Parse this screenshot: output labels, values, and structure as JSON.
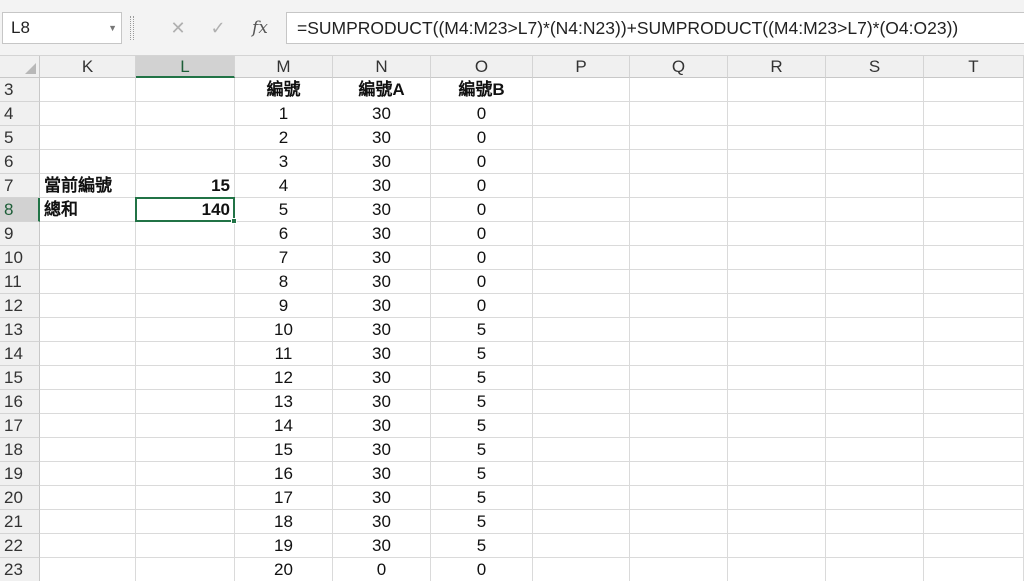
{
  "name_box": {
    "value": "L8"
  },
  "formula_bar": {
    "cancel_icon": "close-icon",
    "enter_icon": "check-icon",
    "fx_label": "fx",
    "formula": "=SUMPRODUCT((M4:M23>L7)*(N4:N23))+SUMPRODUCT((M4:M23>L7)*(O4:O23))"
  },
  "columns": [
    "K",
    "L",
    "M",
    "N",
    "O",
    "P",
    "Q",
    "R",
    "S",
    "T"
  ],
  "active_column": "L",
  "active_row": "8",
  "rows": [
    {
      "num": "3",
      "K": "",
      "L": "",
      "M": "編號",
      "N": "編號A",
      "O": "編號B"
    },
    {
      "num": "4",
      "K": "",
      "L": "",
      "M": "1",
      "N": "30",
      "O": "0"
    },
    {
      "num": "5",
      "K": "",
      "L": "",
      "M": "2",
      "N": "30",
      "O": "0"
    },
    {
      "num": "6",
      "K": "",
      "L": "",
      "M": "3",
      "N": "30",
      "O": "0"
    },
    {
      "num": "7",
      "K": "當前編號",
      "L": "15",
      "M": "4",
      "N": "30",
      "O": "0"
    },
    {
      "num": "8",
      "K": "總和",
      "L": "140",
      "M": "5",
      "N": "30",
      "O": "0"
    },
    {
      "num": "9",
      "K": "",
      "L": "",
      "M": "6",
      "N": "30",
      "O": "0"
    },
    {
      "num": "10",
      "K": "",
      "L": "",
      "M": "7",
      "N": "30",
      "O": "0"
    },
    {
      "num": "11",
      "K": "",
      "L": "",
      "M": "8",
      "N": "30",
      "O": "0"
    },
    {
      "num": "12",
      "K": "",
      "L": "",
      "M": "9",
      "N": "30",
      "O": "0"
    },
    {
      "num": "13",
      "K": "",
      "L": "",
      "M": "10",
      "N": "30",
      "O": "5"
    },
    {
      "num": "14",
      "K": "",
      "L": "",
      "M": "11",
      "N": "30",
      "O": "5"
    },
    {
      "num": "15",
      "K": "",
      "L": "",
      "M": "12",
      "N": "30",
      "O": "5"
    },
    {
      "num": "16",
      "K": "",
      "L": "",
      "M": "13",
      "N": "30",
      "O": "5"
    },
    {
      "num": "17",
      "K": "",
      "L": "",
      "M": "14",
      "N": "30",
      "O": "5"
    },
    {
      "num": "18",
      "K": "",
      "L": "",
      "M": "15",
      "N": "30",
      "O": "5"
    },
    {
      "num": "19",
      "K": "",
      "L": "",
      "M": "16",
      "N": "30",
      "O": "5"
    },
    {
      "num": "20",
      "K": "",
      "L": "",
      "M": "17",
      "N": "30",
      "O": "5"
    },
    {
      "num": "21",
      "K": "",
      "L": "",
      "M": "18",
      "N": "30",
      "O": "5"
    },
    {
      "num": "22",
      "K": "",
      "L": "",
      "M": "19",
      "N": "30",
      "O": "5"
    },
    {
      "num": "23",
      "K": "",
      "L": "",
      "M": "20",
      "N": "0",
      "O": "0"
    }
  ],
  "colors": {
    "selection": "#217346",
    "header_bg": "#f0f0f0",
    "gridline": "#dadada"
  }
}
